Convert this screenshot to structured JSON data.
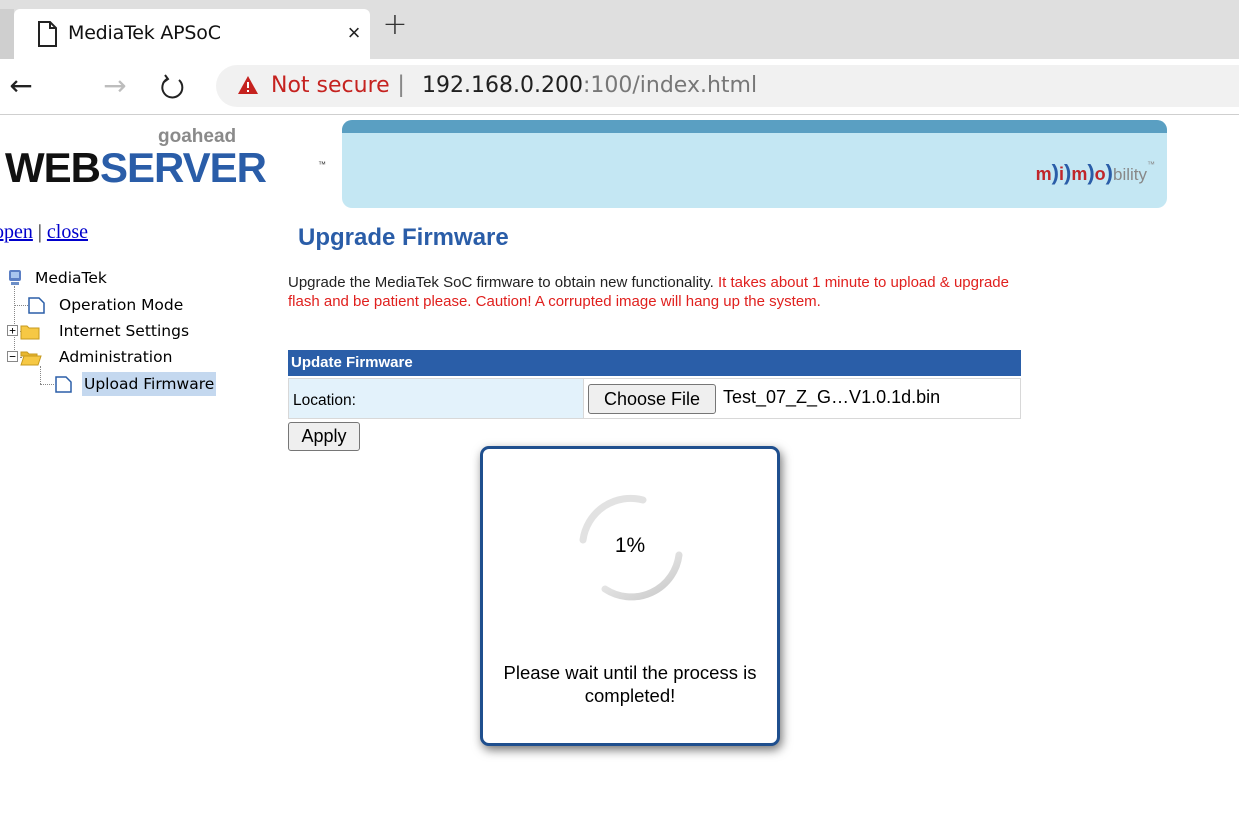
{
  "browser": {
    "tab_title": "MediaTek APSoC",
    "tab_close_glyph": "×",
    "new_tab_glyph": "+",
    "security_label": "Not secure",
    "separator": "|",
    "url_host": "192.168.0.200",
    "url_rest": ":100/index.html",
    "back_glyph": "←",
    "forward_glyph": "→",
    "reload_glyph": "↻"
  },
  "header": {
    "goahead": "goahead",
    "web": "WEB",
    "server": "SERVER",
    "tm": "™",
    "mimo": {
      "m1": "m",
      "i": "i",
      "m2": "m",
      "o": "o",
      "bility": "bility",
      "tm": "™"
    }
  },
  "sidebar": {
    "open_label": "open",
    "divider": "|",
    "close_label": "close",
    "tree": {
      "root": "MediaTek",
      "items": [
        {
          "label": "Operation Mode"
        },
        {
          "label": "Internet Settings"
        },
        {
          "label": "Administration"
        },
        {
          "label": "Upload Firmware"
        }
      ]
    }
  },
  "main": {
    "title": "Upgrade Firmware",
    "desc_normal": "Upgrade the MediaTek SoC firmware to obtain new functionality. ",
    "desc_warning": "It takes about 1 minute to upload & upgrade flash and be patient please. Caution! A corrupted image will hang up the system.",
    "table_header": "Update Firmware",
    "location_label": "Location:",
    "choose_file_label": "Choose File",
    "file_name": "Test_07_Z_G…V1.0.1d.bin",
    "apply_label": "Apply"
  },
  "dialog": {
    "progress_text": "1%",
    "progress_fraction": 0.01,
    "message": "Please wait until the process is completed!"
  },
  "colors": {
    "brand_blue": "#2a5da8",
    "warning_red": "#e0201e",
    "banner_bg": "#c4e7f3",
    "table_header_bg": "#2a5ea8"
  }
}
